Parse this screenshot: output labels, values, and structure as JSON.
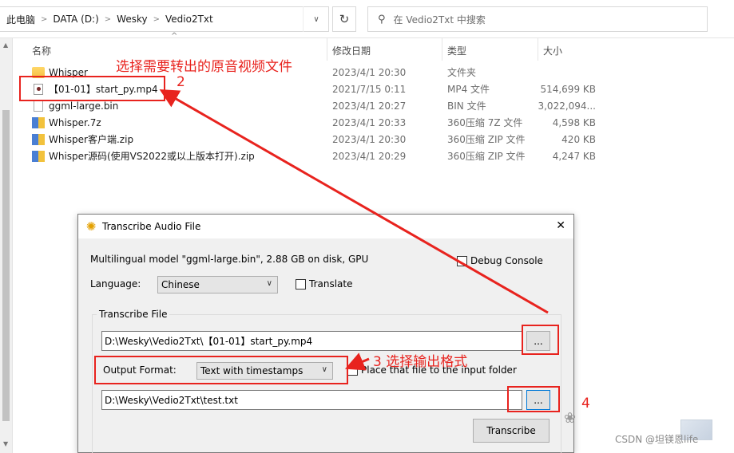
{
  "explorer": {
    "breadcrumb": [
      "此电脑",
      "DATA (D:)",
      "Wesky",
      "Vedio2Txt"
    ],
    "search_placeholder": "在 Vedio2Txt 中搜索",
    "columns": [
      "名称",
      "修改日期",
      "类型",
      "大小"
    ],
    "files": [
      {
        "name": "Whisper",
        "date": "2023/4/1 20:30",
        "type": "文件夹",
        "size": "",
        "icon": "folder-icon"
      },
      {
        "name": "【01-01】start_py.mp4",
        "date": "2021/7/15 0:11",
        "type": "MP4 文件",
        "size": "514,699 KB",
        "icon": "video-file-icon"
      },
      {
        "name": "ggml-large.bin",
        "date": "2023/4/1 20:27",
        "type": "BIN 文件",
        "size": "3,022,094...",
        "icon": "file-icon"
      },
      {
        "name": "Whisper.7z",
        "date": "2023/4/1 20:33",
        "type": "360压缩 7Z 文件",
        "size": "4,598 KB",
        "icon": "archive-icon"
      },
      {
        "name": "Whisper客户端.zip",
        "date": "2023/4/1 20:30",
        "type": "360压缩 ZIP 文件",
        "size": "420 KB",
        "icon": "archive-icon"
      },
      {
        "name": "Whisper源码(使用VS2022或以上版本打开).zip",
        "date": "2023/4/1 20:29",
        "type": "360压缩 ZIP 文件",
        "size": "4,247 KB",
        "icon": "archive-icon"
      }
    ]
  },
  "dialog": {
    "title": "Transcribe Audio File",
    "model_info": "Multilingual model \"ggml-large.bin\", 2.88 GB on disk, GPU",
    "debug_console_label": "Debug Console",
    "language_label": "Language:",
    "language_value": "Chinese",
    "translate_label": "Translate",
    "transcribe_file_group": "Transcribe File",
    "input_path": "D:\\Wesky\\Vedio2Txt\\【01-01】start_py.mp4",
    "browse_label": "...",
    "output_format_label": "Output Format:",
    "output_format_value": "Text with timestamps",
    "place_folder_label": "Place that file to the input folder",
    "output_path": "D:\\Wesky\\Vedio2Txt\\test.txt",
    "transcribe_button": "Transcribe"
  },
  "annotations": {
    "step1_text": "选择需要转出的原音视频文件",
    "step2_num": "2",
    "step3_text": "3 选择输出格式",
    "step4_num": "4"
  },
  "watermark": "CSDN @坦镁恩life",
  "colors": {
    "annotation_red": "#e8231e",
    "focus_blue": "#0078d7"
  }
}
